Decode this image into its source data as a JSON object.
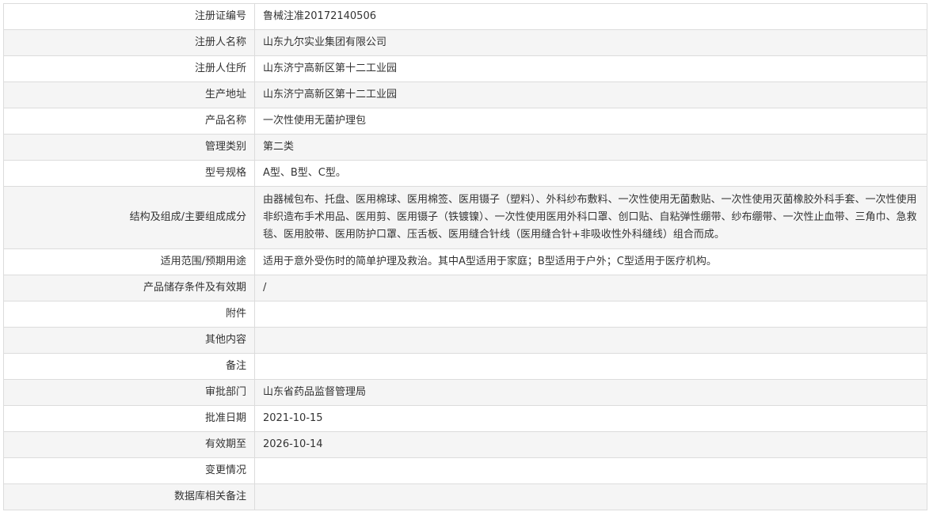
{
  "rows": [
    {
      "label": "注册证编号",
      "value": "鲁械注准20172140506"
    },
    {
      "label": "注册人名称",
      "value": "山东九尔实业集团有限公司"
    },
    {
      "label": "注册人住所",
      "value": "山东济宁高新区第十二工业园"
    },
    {
      "label": "生产地址",
      "value": "山东济宁高新区第十二工业园"
    },
    {
      "label": "产品名称",
      "value": "一次性使用无菌护理包"
    },
    {
      "label": "管理类别",
      "value": "第二类"
    },
    {
      "label": "型号规格",
      "value": "A型、B型、C型。"
    },
    {
      "label": "结构及组成/主要组成成分",
      "value": "由器械包布、托盘、医用棉球、医用棉签、医用镊子（塑料）、外科纱布敷料、一次性使用无菌敷贴、一次性使用灭菌橡胶外科手套、一次性使用非织造布手术用品、医用剪、医用镊子（铁镀镍）、一次性使用医用外科口罩、创口贴、自粘弹性绷带、纱布绷带、一次性止血带、三角巾、急救毯、医用胶带、医用防护口罩、压舌板、医用缝合针线（医用缝合针+非吸收性外科缝线）组合而成。"
    },
    {
      "label": "适用范围/预期用途",
      "value": "适用于意外受伤时的简单护理及救治。其中A型适用于家庭；B型适用于户外；C型适用于医疗机构。"
    },
    {
      "label": "产品储存条件及有效期",
      "value": "/"
    },
    {
      "label": "附件",
      "value": ""
    },
    {
      "label": "其他内容",
      "value": ""
    },
    {
      "label": "备注",
      "value": ""
    },
    {
      "label": "审批部门",
      "value": "山东省药品监督管理局"
    },
    {
      "label": "批准日期",
      "value": "2021-10-15"
    },
    {
      "label": "有效期至",
      "value": "2026-10-14"
    },
    {
      "label": "变更情况",
      "value": ""
    },
    {
      "label": "数据库相关备注",
      "value": ""
    }
  ]
}
